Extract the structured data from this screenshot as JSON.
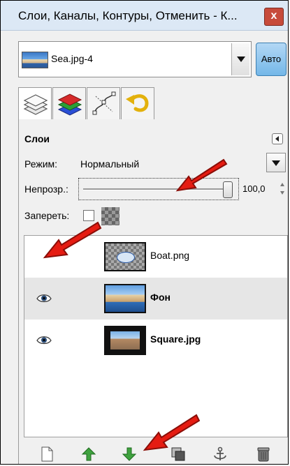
{
  "window": {
    "title": "Слои, Каналы, Контуры, Отменить - К...",
    "close_label": "x"
  },
  "image_selector": {
    "name": "Sea.jpg-4",
    "auto_label": "Авто"
  },
  "tabs": [
    {
      "icon": "layers-tab-icon"
    },
    {
      "icon": "channels-tab-icon"
    },
    {
      "icon": "paths-tab-icon"
    },
    {
      "icon": "undo-tab-icon"
    }
  ],
  "layers_panel": {
    "title": "Слои",
    "mode_label": "Режим:",
    "mode_value": "Нормальный",
    "opacity_label": "Непрозр.:",
    "opacity_value": "100,0",
    "lock_label": "Запереть:"
  },
  "layers": [
    {
      "name": "Boat.png",
      "visible": false,
      "bold": false,
      "selected": false
    },
    {
      "name": "Фон",
      "visible": true,
      "bold": true,
      "selected": true
    },
    {
      "name": "Square.jpg",
      "visible": true,
      "bold": true,
      "selected": false
    }
  ],
  "bottom_icons": [
    "new-layer-icon",
    "raise-layer-icon",
    "lower-layer-icon",
    "duplicate-layer-icon",
    "anchor-layer-icon",
    "delete-layer-icon"
  ],
  "colors": {
    "annotation_arrow": "#e51c12",
    "raise_lower": "#3fa23f",
    "selected_row": "#e6e6e6"
  }
}
